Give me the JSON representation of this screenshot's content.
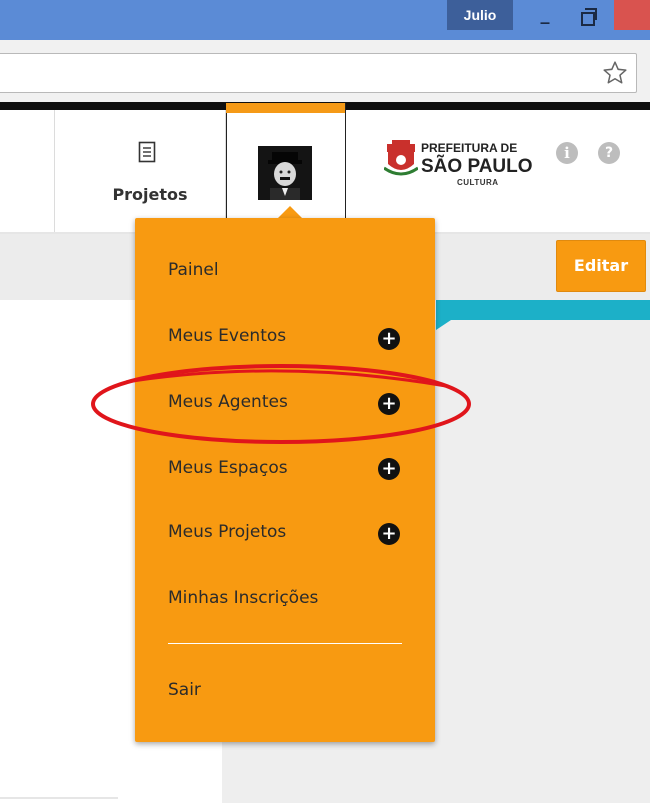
{
  "browser": {
    "user": "Julio",
    "minimize_glyph": "_",
    "colors": {
      "titlebar": "#5b8bd6",
      "close": "#d9534f"
    }
  },
  "header": {
    "nav": [
      {
        "label": "Projetos",
        "icon": "document-icon"
      }
    ],
    "logo": {
      "line1": "PREFEITURA DE",
      "line2": "SÃO PAULO",
      "line3": "CULTURA"
    },
    "info_glyph": "i",
    "help_glyph": "?"
  },
  "page": {
    "edit_label": "Editar",
    "accent": "#f89a11",
    "teal": "#1cb0c8"
  },
  "menu": {
    "items": [
      {
        "label": "Painel",
        "plus": false
      },
      {
        "label": "Meus Eventos",
        "plus": true
      },
      {
        "label": "Meus Agentes",
        "plus": true,
        "highlighted": true
      },
      {
        "label": "Meus Espaços",
        "plus": true
      },
      {
        "label": "Meus Projetos",
        "plus": true
      },
      {
        "label": "Minhas Inscrições",
        "plus": false
      },
      {
        "label": "Sair",
        "plus": false
      }
    ],
    "plus_glyph": "+"
  }
}
